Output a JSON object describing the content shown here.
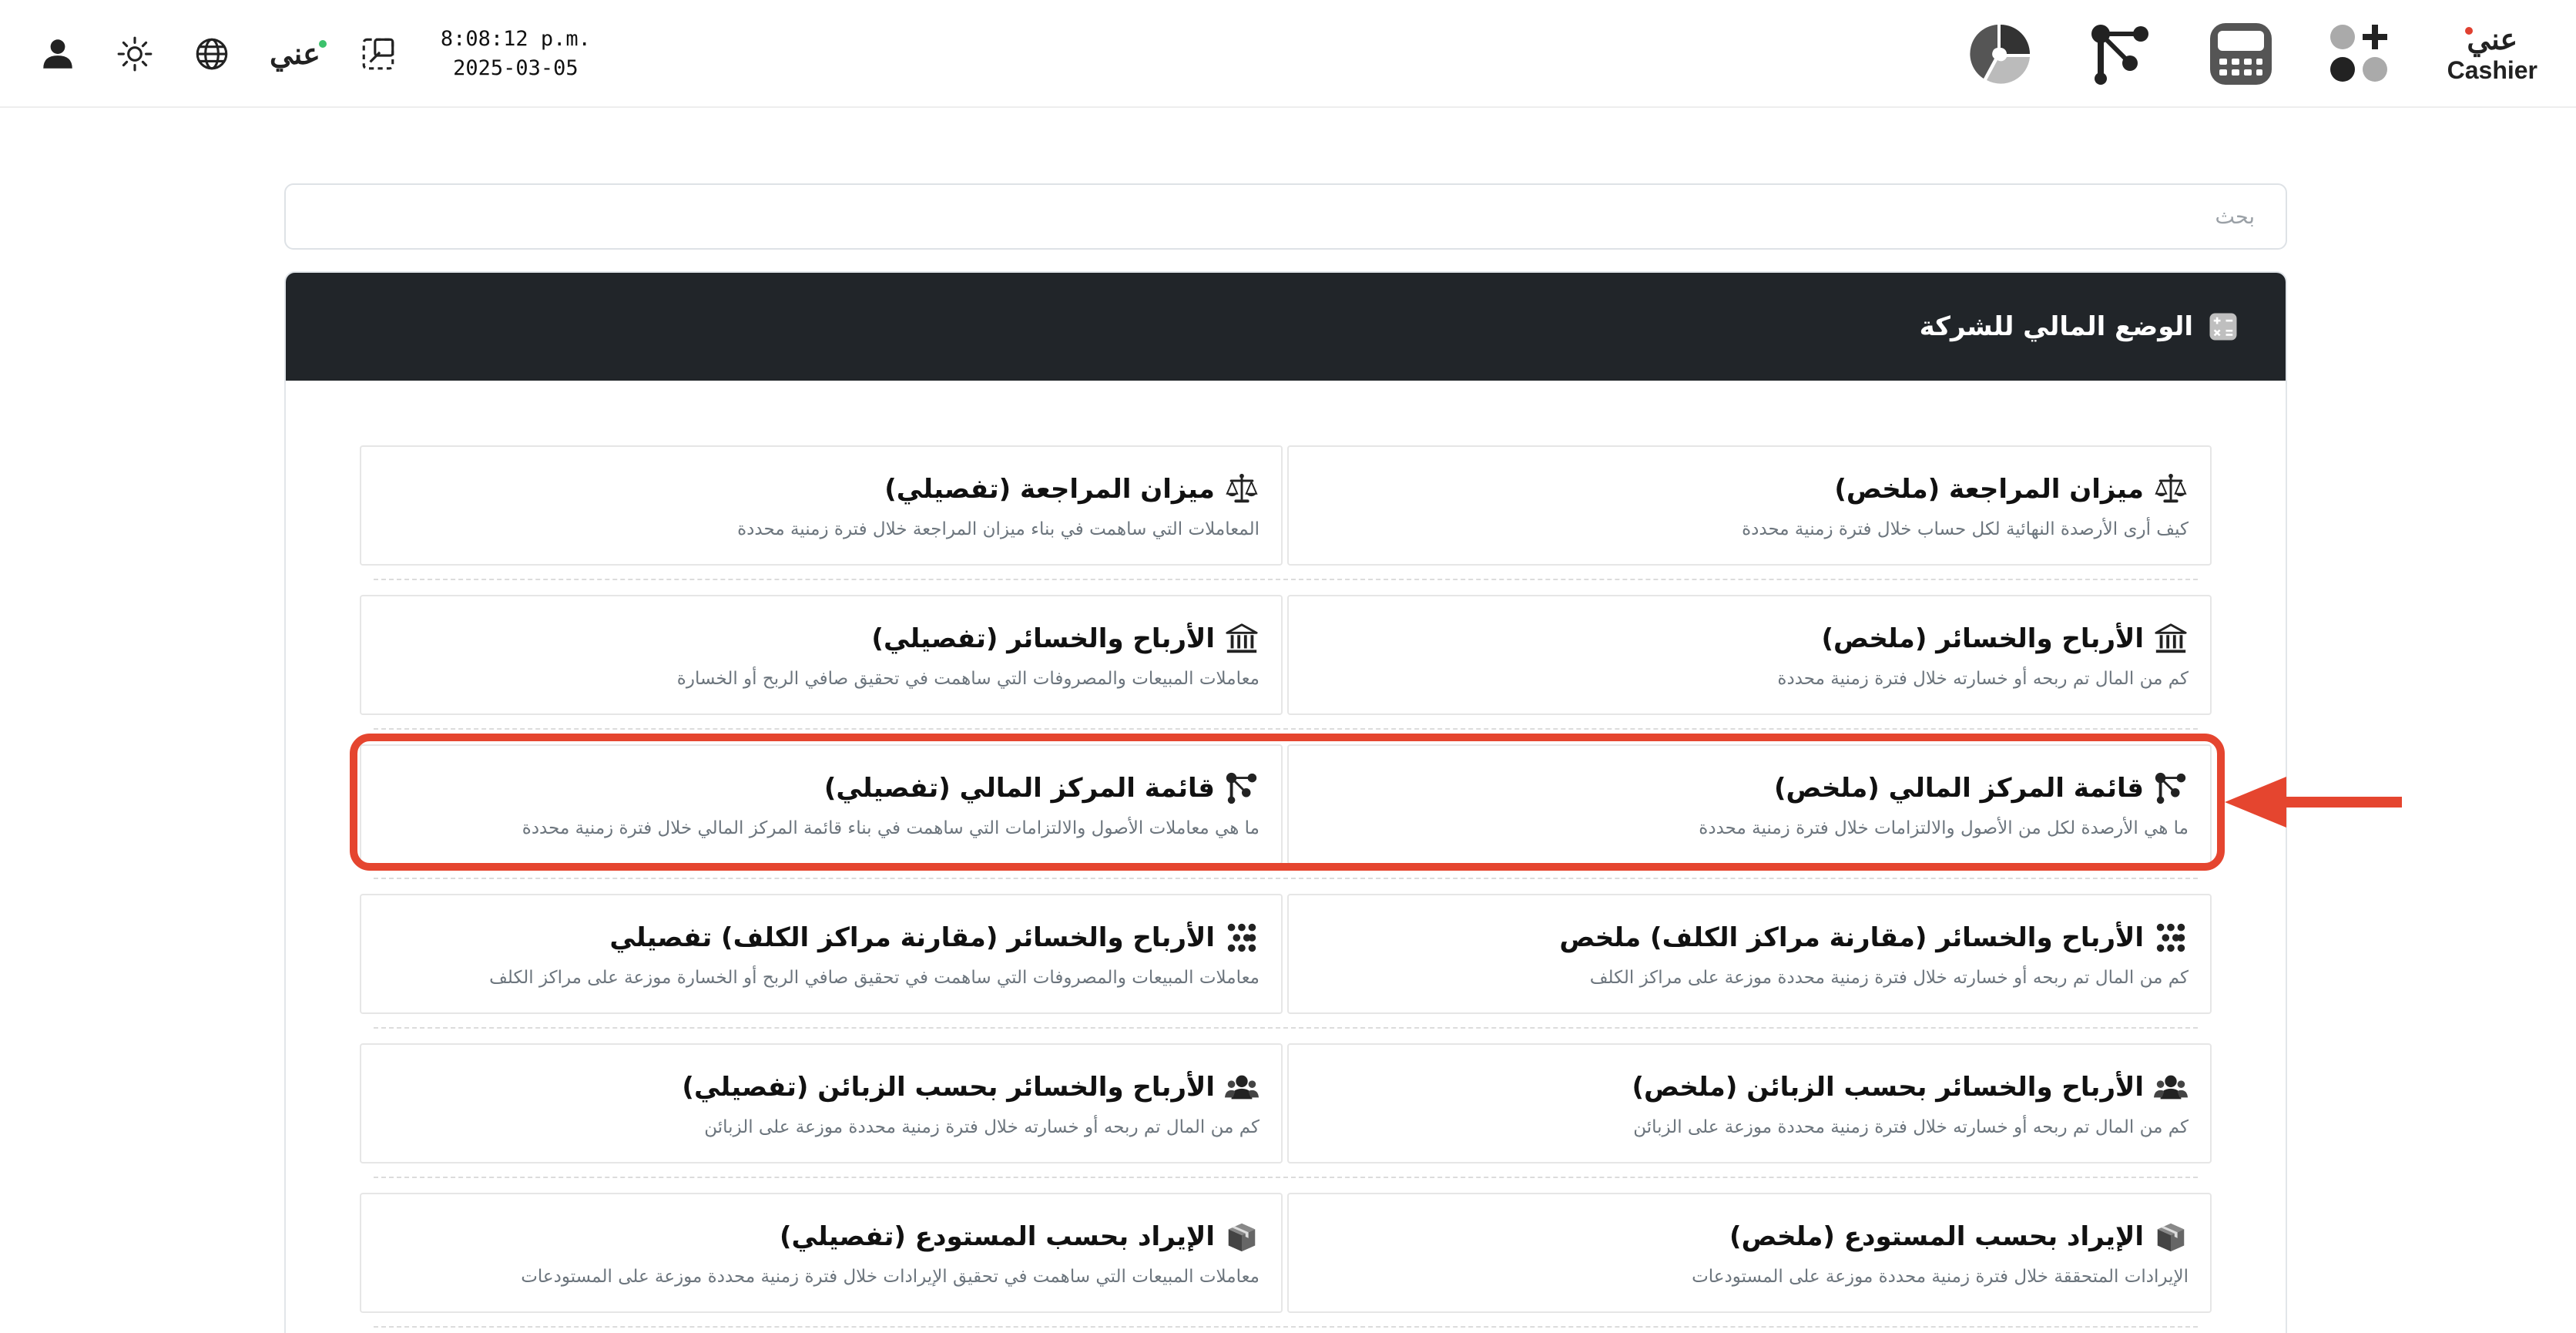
{
  "topbar": {
    "clock_time": "8:08:12 p.m.",
    "clock_date": "2025-03-05",
    "brand_logo_text": "ﻋﻨﻲ",
    "icons_left": [
      "user-icon",
      "brightness-icon",
      "globe-icon",
      "brand-logo",
      "screenshot-icon"
    ],
    "apps_right": [
      "pie-chart-icon",
      "network-icon",
      "calculator-icon",
      "apps-icon"
    ],
    "cashier_logo_text": "ﻋﻨﻲ",
    "cashier_label": "Cashier"
  },
  "search": {
    "placeholder": "بحث"
  },
  "section": {
    "title": "الوضع المالي للشركة",
    "icon": "calculator-icon"
  },
  "reports": [
    {
      "right": {
        "title": "ميزان المراجعة (ملخص)",
        "desc": "كيف أرى الأرصدة النهائية لكل حساب خلال فترة زمنية محددة",
        "icon": "scale-icon"
      },
      "left": {
        "title": "ميزان المراجعة (تفصيلي)",
        "desc": "المعاملات التي ساهمت في بناء ميزان المراجعة خلال فترة زمنية محددة",
        "icon": "scale-icon"
      }
    },
    {
      "right": {
        "title": "الأرباح والخسائر (ملخص)",
        "desc": "كم من المال تم ربحه أو خسارته خلال فترة زمنية محددة",
        "icon": "bank-icon"
      },
      "left": {
        "title": "الأرباح والخسائر (تفصيلي)",
        "desc": "معاملات المبيعات والمصروفات التي ساهمت في تحقيق صافي الربح أو الخسارة",
        "icon": "bank-icon"
      }
    },
    {
      "right": {
        "title": "قائمة المركز المالي (ملخص)",
        "desc": "ما هي الأرصدة لكل من الأصول والالتزامات خلال فترة زمنية محددة",
        "icon": "network-icon"
      },
      "left": {
        "title": "قائمة المركز المالي (تفصيلي)",
        "desc": "ما هي معاملات الأصول والالتزامات التي ساهمت في بناء قائمة المركز المالي خلال فترة زمنية محددة",
        "icon": "network-icon"
      }
    },
    {
      "right": {
        "title": "الأرباح والخسائر (مقارنة مراكز الكلف) ملخص",
        "desc": "كم من المال تم ربحه أو خسارته خلال فترة زمنية محددة موزعة على مراكز الكلف",
        "icon": "grid-dots-icon"
      },
      "left": {
        "title": "الأرباح والخسائر (مقارنة مراكز الكلف) تفصيلي",
        "desc": "معاملات المبيعات والمصروفات التي ساهمت في تحقيق صافي الربح أو الخسارة موزعة على مراكز الكلف",
        "icon": "grid-dots-icon"
      }
    },
    {
      "right": {
        "title": "الأرباح والخسائر بحسب الزبائن (ملخص)",
        "desc": "كم من المال تم ربحه أو خسارته خلال فترة زمنية محددة موزعة على الزبائن",
        "icon": "users-icon"
      },
      "left": {
        "title": "الأرباح والخسائر بحسب الزبائن (تفصيلي)",
        "desc": "كم من المال تم ربحه أو خسارته خلال فترة زمنية محددة موزعة على الزبائن",
        "icon": "users-icon"
      }
    },
    {
      "right": {
        "title": "الإيراد بحسب المستودع (ملخص)",
        "desc": "الإيرادات المتحققة خلال فترة زمنية محددة موزعة على المستودعات",
        "icon": "warehouse-box-icon"
      },
      "left": {
        "title": "الإيراد بحسب المستودع (تفصيلي)",
        "desc": "معاملات المبيعات التي ساهمت في تحقيق الإيرادات خلال فترة زمنية محددة موزعة على المستودعات",
        "icon": "warehouse-box-icon"
      }
    }
  ],
  "annotation": {
    "highlight_color": "#e5452f",
    "highlighted_row": 3
  },
  "colors": {
    "header_bg": "#212529",
    "text": "#111111",
    "muted": "#6c757d",
    "border": "#e6e6e6"
  }
}
